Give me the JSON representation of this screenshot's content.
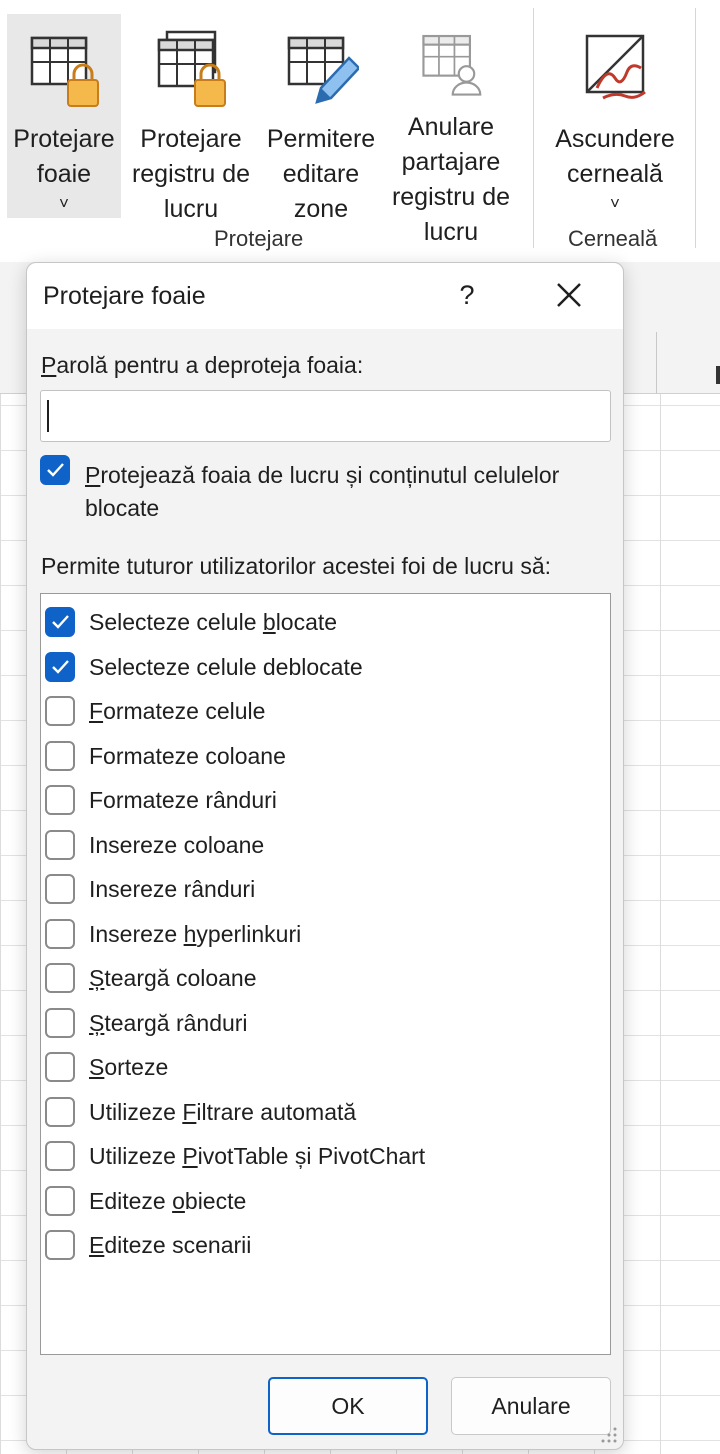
{
  "ribbon": {
    "buttons": [
      {
        "id": "protect-sheet",
        "lines": [
          "Protejare",
          "foaie"
        ],
        "has_dropdown": true,
        "active": true,
        "icon": "sheet-lock-icon"
      },
      {
        "id": "protect-workbook",
        "lines": [
          "Protejare",
          "registru de",
          "lucru"
        ],
        "has_dropdown": false,
        "icon": "workbook-lock-icon"
      },
      {
        "id": "allow-edit-ranges",
        "lines": [
          "Permitere",
          "editare",
          "zone"
        ],
        "has_dropdown": false,
        "icon": "sheet-pencil-icon"
      },
      {
        "id": "unshare-workbook",
        "lines": [
          "Anulare",
          "partajare",
          "registru de",
          "lucru"
        ],
        "has_dropdown": false,
        "icon": "sheet-person-icon"
      },
      {
        "id": "hide-ink",
        "lines": [
          "Ascundere",
          "cerneală"
        ],
        "has_dropdown": true,
        "icon": "ink-icon"
      }
    ],
    "groups": {
      "protect": "Protejare",
      "ink": "Cerneală"
    },
    "chevron": "˅"
  },
  "dialog": {
    "title": "Protejare foaie",
    "help": "?",
    "password_label_first": "P",
    "password_label_rest": "arolă pentru a deproteja foaia:",
    "password_value": "",
    "protect_check_first": "P",
    "protect_check_rest_line1": "rotejează foaia de lucru și conținutul celulelor",
    "protect_check_line2": "blocate",
    "protect_checked": true,
    "allow_label": "Permite tuturor utilizatorilor acestei foi de lucru să:",
    "permissions": [
      {
        "pre": "Selecteze celule ",
        "u": "b",
        "post": "locate",
        "checked": true
      },
      {
        "pre": "Selecteze celule deblocate",
        "u": "",
        "post": "",
        "checked": true
      },
      {
        "pre": "",
        "u": "F",
        "post": "ormateze celule",
        "checked": false
      },
      {
        "pre": "Formateze coloane",
        "u": "",
        "post": "",
        "checked": false
      },
      {
        "pre": "Formateze rânduri",
        "u": "",
        "post": "",
        "checked": false
      },
      {
        "pre": "Insereze coloane",
        "u": "",
        "post": "",
        "checked": false
      },
      {
        "pre": "Insereze rânduri",
        "u": "",
        "post": "",
        "checked": false
      },
      {
        "pre": "Insereze ",
        "u": "h",
        "post": "yperlinkuri",
        "checked": false
      },
      {
        "pre": "",
        "u": "Ș",
        "post": "teargă coloane",
        "checked": false
      },
      {
        "pre": "",
        "u": "Ș",
        "post": "teargă rânduri",
        "checked": false
      },
      {
        "pre": "",
        "u": "S",
        "post": "orteze",
        "checked": false
      },
      {
        "pre": "Utilizeze ",
        "u": "F",
        "post": "iltrare automată",
        "checked": false
      },
      {
        "pre": "Utilizeze ",
        "u": "P",
        "post": "ivotTable și PivotChart",
        "checked": false
      },
      {
        "pre": "Editeze ",
        "u": "o",
        "post": "biecte",
        "checked": false
      },
      {
        "pre": "",
        "u": "E",
        "post": "diteze scenarii",
        "checked": false
      }
    ],
    "ok": "OK",
    "cancel": "Anulare"
  },
  "colors": {
    "accent": "#0f62c8",
    "dialog_bg": "#f3f3f3",
    "active_button_bg": "#e8e8e8"
  }
}
